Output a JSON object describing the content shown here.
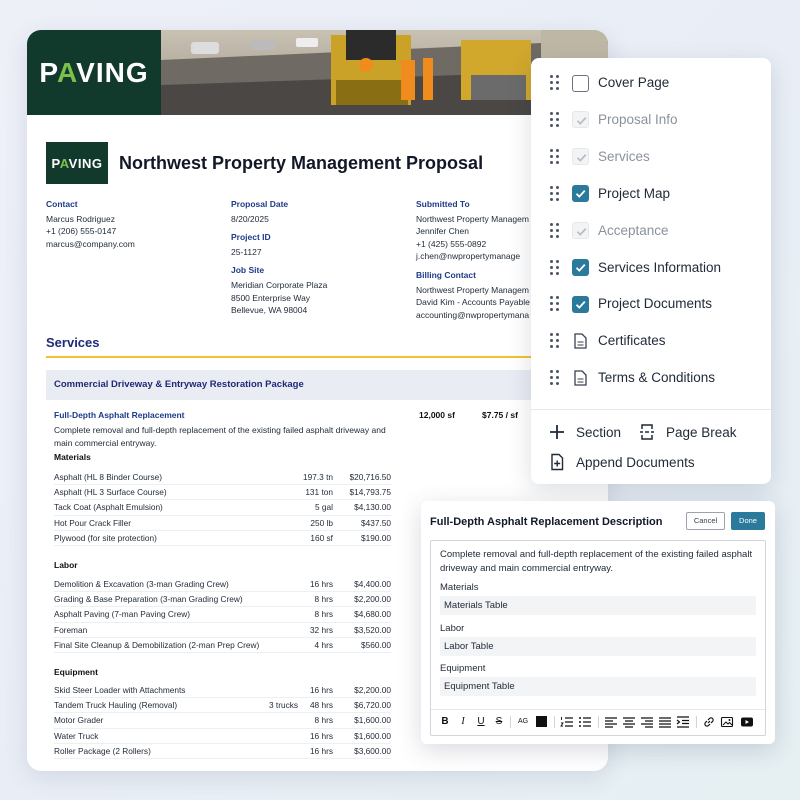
{
  "brand": {
    "logo_text_pre": "P",
    "logo_text_accent": "A",
    "logo_text_post": "VING",
    "accent": "#7cc04b",
    "dark": "#123a2c"
  },
  "proposal": {
    "title": "Northwest Property Management Proposal",
    "contact": {
      "label": "Contact",
      "name": "Marcus Rodriguez",
      "phone": "+1 (206) 555-0147",
      "email": "marcus@company.com"
    },
    "proposal_date": {
      "label": "Proposal Date",
      "value": "8/20/2025"
    },
    "project_id": {
      "label": "Project ID",
      "value": "25-1127"
    },
    "job_site": {
      "label": "Job Site",
      "line1": "Meridian Corporate Plaza",
      "line2": "8500 Enterprise Way",
      "line3": "Bellevue, WA 98004"
    },
    "submitted_to": {
      "label": "Submitted To",
      "company": "Northwest Property Managem",
      "name": "Jennifer Chen",
      "phone": "+1 (425) 555-0892",
      "email": "j.chen@nwpropertymanage"
    },
    "billing_contact": {
      "label": "Billing Contact",
      "company": "Northwest Property Managem",
      "name": "David Kim - Accounts Payable",
      "email": "accounting@nwpropertymana"
    }
  },
  "services": {
    "heading": "Services",
    "package_title": "Commercial Driveway & Entryway Restoration Package",
    "item": {
      "title": "Full-Depth Asphalt Replacement",
      "qty": "12,000 sf",
      "price": "$7.75 / sf",
      "description": "Complete removal and full-depth replacement of the existing failed asphalt driveway and main commercial entryway."
    },
    "materials_label": "Materials",
    "materials": [
      {
        "name": "Asphalt (HL 8 Binder Course)",
        "note": "",
        "qty": "197.3 tn",
        "total": "$20,716.50"
      },
      {
        "name": "Asphalt (HL 3 Surface Course)",
        "note": "",
        "qty": "131 ton",
        "total": "$14,793.75"
      },
      {
        "name": "Tack Coat (Asphalt Emulsion)",
        "note": "",
        "qty": "5 gal",
        "total": "$4,130.00"
      },
      {
        "name": "Hot Pour Crack Filler",
        "note": "",
        "qty": "250 lb",
        "total": "$437.50"
      },
      {
        "name": "Plywood (for site protection)",
        "note": "",
        "qty": "160 sf",
        "total": "$190.00"
      }
    ],
    "labor_label": "Labor",
    "labor": [
      {
        "name": "Demolition & Excavation (3-man Grading Crew)",
        "note": "",
        "qty": "16 hrs",
        "total": "$4,400.00"
      },
      {
        "name": "Grading & Base Preparation (3-man Grading Crew)",
        "note": "",
        "qty": "8 hrs",
        "total": "$2,200.00"
      },
      {
        "name": "Asphalt Paving (7-man Paving Crew)",
        "note": "",
        "qty": "8 hrs",
        "total": "$4,680.00"
      },
      {
        "name": "Foreman",
        "note": "",
        "qty": "32 hrs",
        "total": "$3,520.00"
      },
      {
        "name": "Final Site Cleanup & Demobilization (2-man Prep Crew)",
        "note": "",
        "qty": "4 hrs",
        "total": "$560.00"
      }
    ],
    "equipment_label": "Equipment",
    "equipment": [
      {
        "name": "Skid Steer Loader with Attachments",
        "note": "",
        "qty": "16 hrs",
        "total": "$2,200.00"
      },
      {
        "name": "Tandem Truck Hauling (Removal)",
        "note": "3 trucks",
        "qty": "48 hrs",
        "total": "$6,720.00"
      },
      {
        "name": "Motor Grader",
        "note": "",
        "qty": "8 hrs",
        "total": "$1,600.00"
      },
      {
        "name": "Water Truck",
        "note": "",
        "qty": "16 hrs",
        "total": "$1,600.00"
      },
      {
        "name": "Roller Package (2 Rollers)",
        "note": "",
        "qty": "16 hrs",
        "total": "$3,600.00"
      }
    ]
  },
  "sections_panel": {
    "items": [
      {
        "label": "Cover Page",
        "state": "unchecked"
      },
      {
        "label": "Proposal Info",
        "state": "disabled"
      },
      {
        "label": "Services",
        "state": "disabled"
      },
      {
        "label": "Project Map",
        "state": "checked"
      },
      {
        "label": "Acceptance",
        "state": "disabled"
      },
      {
        "label": "Services Information",
        "state": "checked"
      },
      {
        "label": "Project Documents",
        "state": "checked"
      },
      {
        "label": "Certificates",
        "state": "document"
      },
      {
        "label": "Terms & Conditions",
        "state": "document"
      }
    ],
    "add_section": "Section",
    "page_break": "Page Break",
    "append_documents": "Append Documents",
    "check_color": "#2b7a9c"
  },
  "editor": {
    "title": "Full-Depth Asphalt Replacement Description",
    "cancel": "Cancel",
    "done": "Done",
    "text": "Complete removal and full-depth replacement of the existing failed asphalt driveway and main commercial entryway.",
    "materials_label": "Materials",
    "materials_chip": "Materials Table",
    "labor_label": "Labor",
    "labor_chip": "Labor Table",
    "equipment_label": "Equipment",
    "equipment_chip": "Equipment Table",
    "toolbar": [
      "bold-icon",
      "italic-icon",
      "underline-icon",
      "strikethrough-icon",
      "font-size-icon",
      "text-color-swatch",
      "numbered-list-icon",
      "bulleted-list-icon",
      "align-left-icon",
      "align-center-icon",
      "align-right-icon",
      "align-justify-icon",
      "indent-icon",
      "link-icon",
      "image-icon",
      "video-icon"
    ]
  }
}
